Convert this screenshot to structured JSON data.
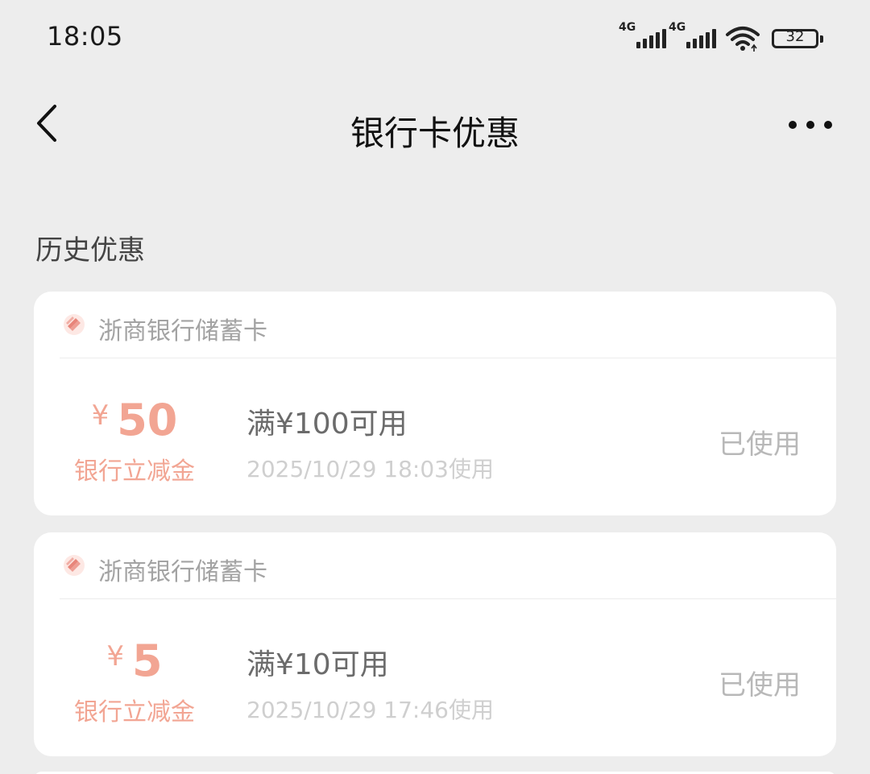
{
  "status_bar": {
    "time": "18:05",
    "network1": "4G",
    "network2": "4G",
    "battery": "32"
  },
  "nav": {
    "title": "银行卡优惠",
    "back_icon": "chevron-left-icon",
    "more_icon": "more-dots-icon"
  },
  "section_title": "历史优惠",
  "colors": {
    "amount": "#f2a593",
    "logo": "#e8857a",
    "background": "#ededed"
  },
  "coupons": [
    {
      "bank": "浙商银行储蓄卡",
      "currency": "¥",
      "amount": "50",
      "amount_label": "银行立减金",
      "condition": "满¥100可用",
      "used_time": "2025/10/29 18:03使用",
      "status": "已使用"
    },
    {
      "bank": "浙商银行储蓄卡",
      "currency": "¥",
      "amount": "5",
      "amount_label": "银行立减金",
      "condition": "满¥10可用",
      "used_time": "2025/10/29 17:46使用",
      "status": "已使用"
    }
  ]
}
